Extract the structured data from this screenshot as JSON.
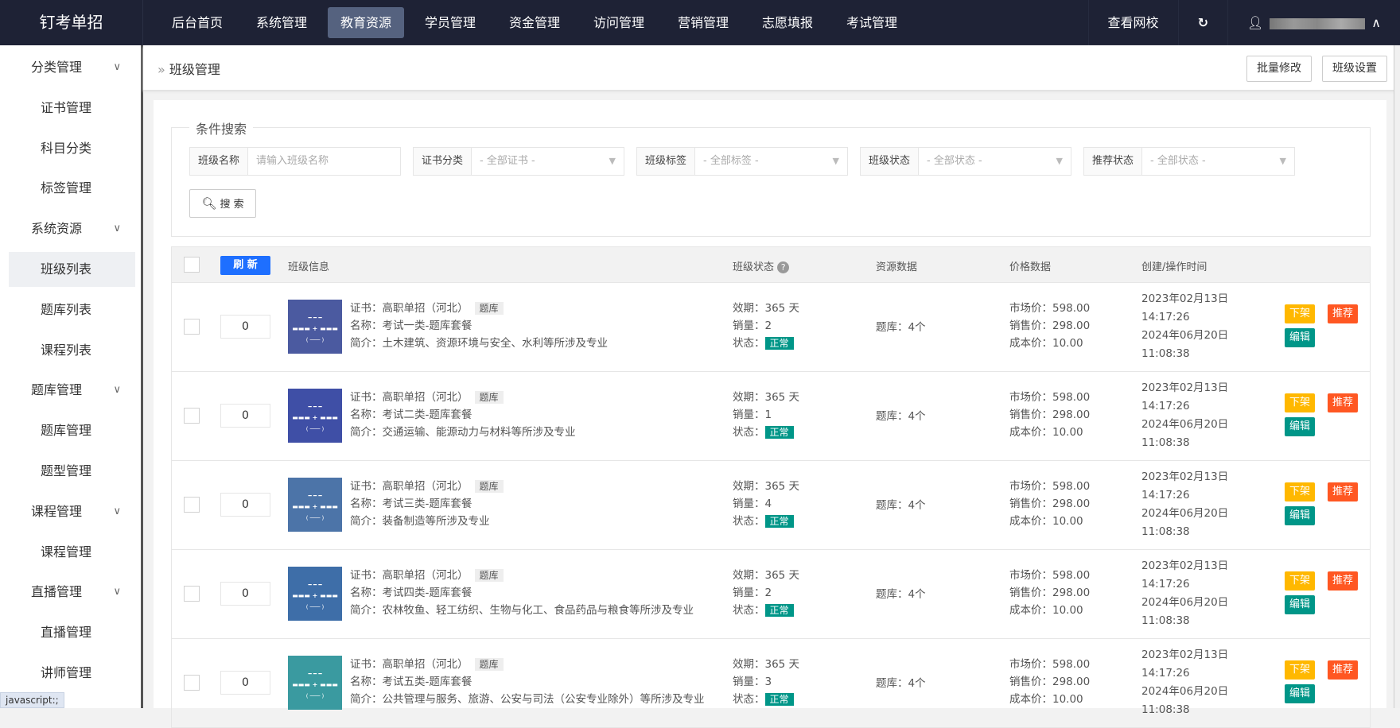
{
  "app": {
    "logo": "钉考单招"
  },
  "nav": [
    {
      "label": "后台首页"
    },
    {
      "label": "系统管理"
    },
    {
      "label": "教育资源",
      "active": true
    },
    {
      "label": "学员管理"
    },
    {
      "label": "资金管理"
    },
    {
      "label": "访问管理"
    },
    {
      "label": "营销管理"
    },
    {
      "label": "志愿填报"
    },
    {
      "label": "考试管理"
    }
  ],
  "topright": {
    "view_site": "查看网校",
    "refresh_icon": "refresh-icon",
    "user_icon": "user-icon"
  },
  "sidebar": [
    {
      "label": "分类管理",
      "type": "group"
    },
    {
      "label": "证书管理",
      "type": "sub"
    },
    {
      "label": "科目分类",
      "type": "sub"
    },
    {
      "label": "标签管理",
      "type": "sub"
    },
    {
      "label": "系统资源",
      "type": "group"
    },
    {
      "label": "班级列表",
      "type": "sub",
      "active": true
    },
    {
      "label": "题库列表",
      "type": "sub"
    },
    {
      "label": "课程列表",
      "type": "sub"
    },
    {
      "label": "题库管理",
      "type": "group"
    },
    {
      "label": "题库管理",
      "type": "sub"
    },
    {
      "label": "题型管理",
      "type": "sub"
    },
    {
      "label": "课程管理",
      "type": "group"
    },
    {
      "label": "课程管理",
      "type": "sub"
    },
    {
      "label": "直播管理",
      "type": "group"
    },
    {
      "label": "直播管理",
      "type": "sub"
    },
    {
      "label": "讲师管理",
      "type": "sub"
    }
  ],
  "breadcrumb": {
    "title": "班级管理",
    "batch_edit": "批量修改",
    "class_settings": "班级设置"
  },
  "search": {
    "legend": "条件搜索",
    "fields": [
      {
        "label": "班级名称",
        "placeholder": "请输入班级名称"
      },
      {
        "label": "证书分类",
        "value": "- 全部证书 -"
      },
      {
        "label": "班级标签",
        "value": "- 全部标签 -"
      },
      {
        "label": "班级状态",
        "value": "- 全部状态 -"
      },
      {
        "label": "推荐状态",
        "value": "- 全部状态 -"
      }
    ],
    "button": "搜 索"
  },
  "table": {
    "refresh": "刷 新",
    "headers": {
      "info": "班级信息",
      "status": "班级状态",
      "resource": "资源数据",
      "price": "价格数据",
      "time": "创建/操作时间"
    },
    "rows": [
      {
        "sort": "0",
        "cert": "证书：高职单招（河北）",
        "tag": "题库",
        "name": "名称：考试一类-题库套餐",
        "intro": "简介：土木建筑、资源环境与安全、水利等所涉及专业",
        "validity": "效期：365 天",
        "sales": "销量：2",
        "state_label": "状态：",
        "state": "正常",
        "resource": "题库：4个",
        "market": "市场价：598.00",
        "sale": "销售价：298.00",
        "cost": "成本价：10.00",
        "created_date": "2023年02月13日",
        "created_time": "14:17:26",
        "updated_date": "2024年06月20日",
        "updated_time": "11:08:38",
        "img_color": "#4b5aa0"
      },
      {
        "sort": "0",
        "cert": "证书：高职单招（河北）",
        "tag": "题库",
        "name": "名称：考试二类-题库套餐",
        "intro": "简介：交通运输、能源动力与材料等所涉及专业",
        "validity": "效期：365 天",
        "sales": "销量：1",
        "state_label": "状态：",
        "state": "正常",
        "resource": "题库：4个",
        "market": "市场价：598.00",
        "sale": "销售价：298.00",
        "cost": "成本价：10.00",
        "created_date": "2023年02月13日",
        "created_time": "14:17:26",
        "updated_date": "2024年06月20日",
        "updated_time": "11:08:38",
        "img_color": "#3f4fa6"
      },
      {
        "sort": "0",
        "cert": "证书：高职单招（河北）",
        "tag": "题库",
        "name": "名称：考试三类-题库套餐",
        "intro": "简介：装备制造等所涉及专业",
        "validity": "效期：365 天",
        "sales": "销量：4",
        "state_label": "状态：",
        "state": "正常",
        "resource": "题库：4个",
        "market": "市场价：598.00",
        "sale": "销售价：298.00",
        "cost": "成本价：10.00",
        "created_date": "2023年02月13日",
        "created_time": "14:17:26",
        "updated_date": "2024年06月20日",
        "updated_time": "11:08:38",
        "img_color": "#4c74a8"
      },
      {
        "sort": "0",
        "cert": "证书：高职单招（河北）",
        "tag": "题库",
        "name": "名称：考试四类-题库套餐",
        "intro": "简介：农林牧鱼、轻工纺织、生物与化工、食品药品与粮食等所涉及专业",
        "validity": "效期：365 天",
        "sales": "销量：2",
        "state_label": "状态：",
        "state": "正常",
        "resource": "题库：4个",
        "market": "市场价：598.00",
        "sale": "销售价：298.00",
        "cost": "成本价：10.00",
        "created_date": "2023年02月13日",
        "created_time": "14:17:26",
        "updated_date": "2024年06月20日",
        "updated_time": "11:08:38",
        "img_color": "#3e6ea8"
      },
      {
        "sort": "0",
        "cert": "证书：高职单招（河北）",
        "tag": "题库",
        "name": "名称：考试五类-题库套餐",
        "intro": "简介：公共管理与服务、旅游、公安与司法（公安专业除外）等所涉及专业",
        "validity": "效期：365 天",
        "sales": "销量：3",
        "state_label": "状态：",
        "state": "正常",
        "resource": "题库：4个",
        "market": "市场价：598.00",
        "sale": "销售价：298.00",
        "cost": "成本价：10.00",
        "created_date": "2023年02月13日",
        "created_time": "14:17:26",
        "updated_date": "2024年06月20日",
        "updated_time": "11:08:38",
        "img_color": "#3a9aa0"
      }
    ],
    "actions": {
      "offshelf": "下架",
      "recommend": "推荐",
      "edit": "编辑"
    }
  },
  "statusbar": "javascript:;",
  "colors": {
    "offshelf": "#ffb800",
    "recommend": "#ff5722",
    "edit": "#009688",
    "primary": "#1e6fff"
  }
}
